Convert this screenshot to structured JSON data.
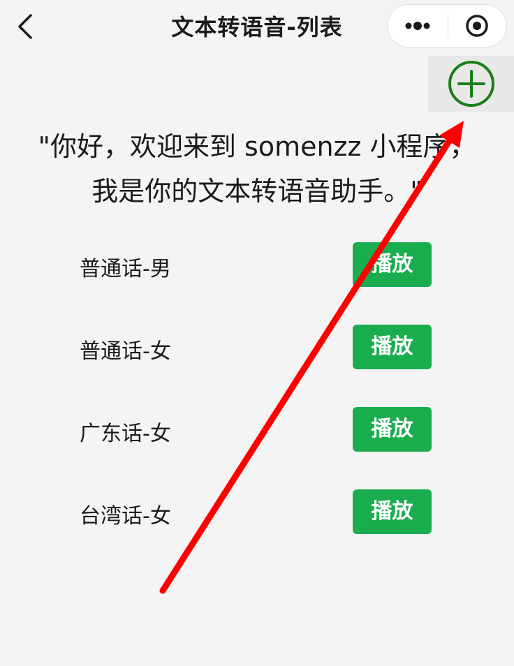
{
  "nav": {
    "title": "文本转语音-列表",
    "back_icon": "chevron-left-icon",
    "more_icon": "more-dots-icon",
    "close_icon": "target-circle-icon"
  },
  "add": {
    "icon": "plus-circle-icon",
    "color": "#1a7f1a"
  },
  "greeting": {
    "line1": "\"你好，欢迎来到 somenzz 小程序，",
    "line2": "我是你的文本转语音助手。\""
  },
  "voices": [
    {
      "label": "普通话-男",
      "button": "播放"
    },
    {
      "label": "普通话-女",
      "button": "播放"
    },
    {
      "label": "广东话-女",
      "button": "播放"
    },
    {
      "label": "台湾话-女",
      "button": "播放"
    }
  ],
  "colors": {
    "play_button": "#1aad4e",
    "annotation_arrow": "#ff0000",
    "background": "#f4f4f4"
  }
}
